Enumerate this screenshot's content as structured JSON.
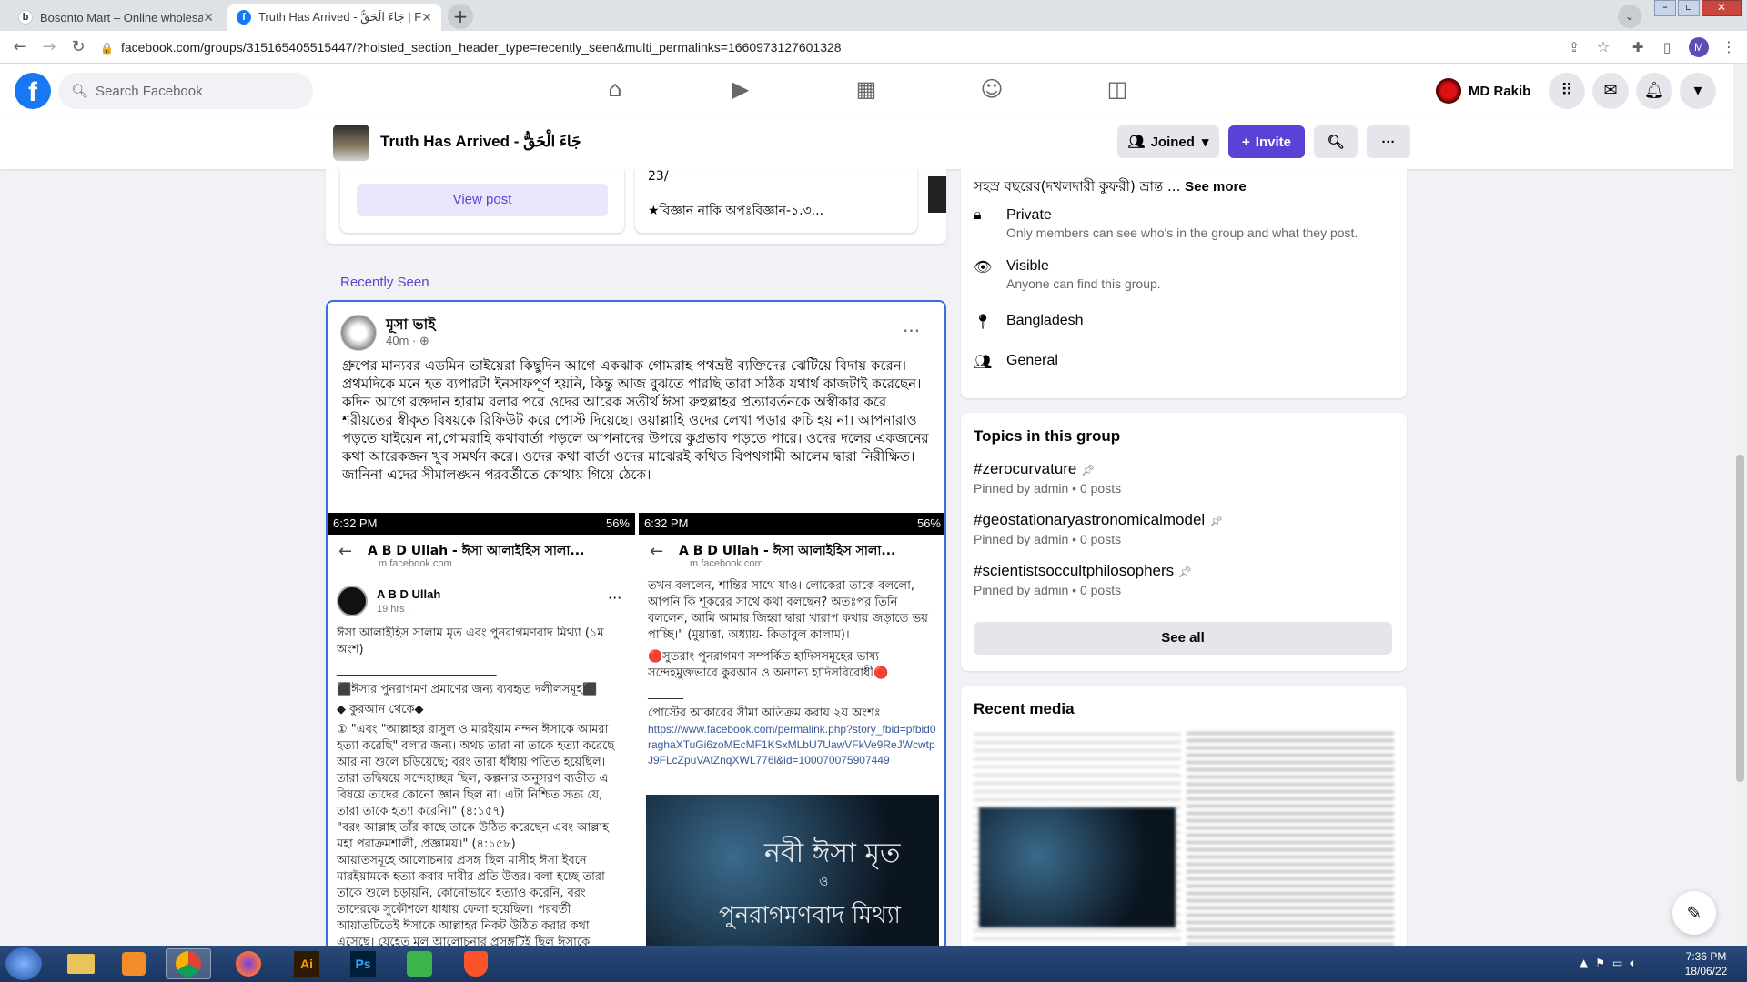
{
  "browser": {
    "tabs": [
      {
        "title": "Bosonto Mart – Online wholesale",
        "favicon": "b"
      },
      {
        "title": "Truth Has Arrived - جَاءَ الْحَقُّ | Face",
        "favicon": "f"
      }
    ],
    "url": "facebook.com/groups/315165405515447/?hoisted_section_header_type=recently_seen&multi_permalinks=1660973127601328",
    "profile_initial": "M"
  },
  "fb": {
    "search_placeholder": "Search Facebook",
    "user_name": "MD Rakib",
    "logo": "f"
  },
  "group": {
    "name": "Truth Has Arrived - جَاءَ الْحَقُّ",
    "joined_label": "Joined",
    "invite_label": "Invite"
  },
  "featured": {
    "view_post_label": "View post",
    "card2_line1": "23/",
    "card2_line2": "★বিজ্ঞান নাকি অপঃবিজ্ঞান-১.৩..."
  },
  "recently_seen_label": "Recently Seen",
  "post": {
    "author": "মূসা ভাই",
    "time": "40m ·",
    "body": "গ্রুপের মান্যবর এডমিন ভাইয়েরা কিছুদিন আগে একঝাক গোমরাহ পথভ্রষ্ট ব্যক্তিদের ঝেটিয়ে বিদায় করেন। প্রথমদিকে মনে হত ব্যপারটা ইনসাফপূর্ণ হয়নি, কিন্তু আজ বুঝতে পারছি তারা সঠিক যথার্থ কাজটাই করেছেন। কদিন আগে রক্তদান হারাম বলার পরে ওদের আরেক সতীর্থ ঈসা রুহুল্লাহর প্রত্যাবর্তনকে অস্বীকার করে শরীয়তের স্বীকৃত বিষয়কে রিফিউট করে পোস্ট দিয়েছে। ওয়াল্লাহি ওদের লেখা পড়ার রুচি হয় না। আপনারাও পড়তে যাইয়েন না,গোমরাহি কথাবার্তা পড়লে আপনাদের উপরে কুপ্রভাব পড়তে পারে। ওদের দলের একজনের কথা আরেকজন খুব সমর্থন করে। ওদের কথা বার্তা ওদের মাঝেরই কথিত বিপথগামী আলেম দ্বারা নিরীক্ষিত। জানিনা এদের সীমালঙ্ঘন পরবর্তীতে কোথায় গিয়ে ঠেকে।",
    "shots": [
      {
        "time": "6:32 PM",
        "battery": "56%",
        "header": "A B D Ullah - ঈসা আলাইহিস সালা...",
        "domain": "m.facebook.com",
        "poster": "A B D Ullah",
        "poster_time": "19 hrs ·",
        "lines": [
          "ঈসা আলাইহিস সালাম মৃত এবং পুনরাগমণবাদ মিথ্যা (১ম অংশ)",
          "___________________________",
          "⬛ঈসার পুনরাগমণ প্রমাণের জন্য ব্যবহৃত দলীলসমূহ⬛",
          "◆ কুরআন থেকে◆",
          "① \"এবং \"আল্লাহর রাসুল ও মারইয়াম নন্দন ঈসাকে আমরা হত্যা করেছি\" বলার জন্য। অথচ তারা না তাকে হত্যা করেছে আর না শুলে চড়িয়েছে; বরং তারা ধাঁধায় পতিত হয়েছিল। তারা তদ্বিষয়ে সন্দেহাচ্ছন্ন ছিল, কল্পনার অনুসরণ ব্যতীত এ বিষয়ে তাদের কোনো জ্ঞান ছিল না। এটা নিশ্চিত সত্য যে, তারা তাকে হত্যা করেনি।\" (৪:১৫৭)",
          "\"বরং আল্লাহ তাঁর কাছে তাকে উঠিত করেছেন এবং আল্লাহ মহা পরাক্রমশালী, প্রজ্ঞাময়।\" (৪:১৫৮)",
          "আয়াতসমূহে আলোচনার প্রসঙ্গ ছিল মাসীহ ঈসা ইবনে মারইয়ামকে হত্যা করার দাবীর প্রতি উত্তর। বলা হচ্ছে তারা তাকে শুলে চড়ায়নি, কোনোভাবে হত্যাও করেনি, বরং তাদেরকে সুকৌশলে ধাধায় ফেলা হয়েছিল। পরবর্তী আয়াতটিতেই ঈসাকে আল্লাহর নিকট উঠিত করার কথা এসেছে। যেহেতু মূল আলোচনার প্রসঙ্গটিই ছিল ঈসাকে হত্যাচেষ্টার ব্যর্থতাকে সামনে আনা, এজন্য আল্লাহর নিকট উঠিত করার আয়াতটিকে ঈসাকে"
        ]
      },
      {
        "time": "6:32 PM",
        "battery": "56%",
        "header": "A B D Ullah - ঈসা আলাইহিস সালা...",
        "domain": "m.facebook.com",
        "lines": [
          "তখন বললেন, শান্তির সাথে যাও। লোকেরা তাকে বললো, আপনি কি শূকরের সাথে কথা বলছেন? অতঃপর তিনি বললেন, আমি আমার জিহ্বা দ্বারা খারাপ কথায় জড়াতে ভয় পাচ্ছি।\" (মুয়াত্তা, অধ্যায়- কিতাবুল কালাম)।",
          "🔴সুতরাং পুনরাগমণ সম্পর্কিত হাদিসসমূহের ভাষ্য সন্দেহমুক্তভাবে কুরআন ও অন্যান্য হাদিসবিরোধী🔴",
          "______",
          "পোস্টের আকারের সীমা অতিক্রম করায় ২য় অংশঃ"
        ],
        "link": "https://www.facebook.com/permalink.php?story_fbid=pfbid0raghaXTuGi6zoMEcMF1KSxMLbU7UawVFkVe9ReJWcwtpJ9FLcZpuVAtZnqXWL776l&id=100070075907449",
        "image_text_1": "নবী ঈসা মৃত",
        "image_text_2": "ও",
        "image_text_3": "পুনরাগমণবাদ মিথ্যা"
      }
    ]
  },
  "about": {
    "partial_text": "সহস্র বছরের(দখলদারী কুফরী) ভ্রান্ত ...",
    "see_more": "See more",
    "items": [
      {
        "icon": "lock-icon",
        "title": "Private",
        "sub": "Only members can see who's in the group and what they post."
      },
      {
        "icon": "eye-icon",
        "title": "Visible",
        "sub": "Anyone can find this group."
      },
      {
        "icon": "location-icon",
        "title": "Bangladesh",
        "sub": ""
      },
      {
        "icon": "people-icon",
        "title": "General",
        "sub": ""
      }
    ]
  },
  "topics": {
    "heading": "Topics in this group",
    "items": [
      {
        "tag": "#zerocurvature",
        "sub": "Pinned by admin • 0 posts"
      },
      {
        "tag": "#geostationaryastronomicalmodel",
        "sub": "Pinned by admin • 0 posts"
      },
      {
        "tag": "#scientistsoccultphilosophers",
        "sub": "Pinned by admin • 0 posts"
      }
    ],
    "see_all": "See all"
  },
  "recent_media": {
    "heading": "Recent media"
  },
  "taskbar": {
    "time": "7:36 PM",
    "date": "18/06/22"
  },
  "colors": {
    "fb_blue": "#1877f2",
    "purple": "#5b42d6",
    "link_blue": "#385898"
  }
}
